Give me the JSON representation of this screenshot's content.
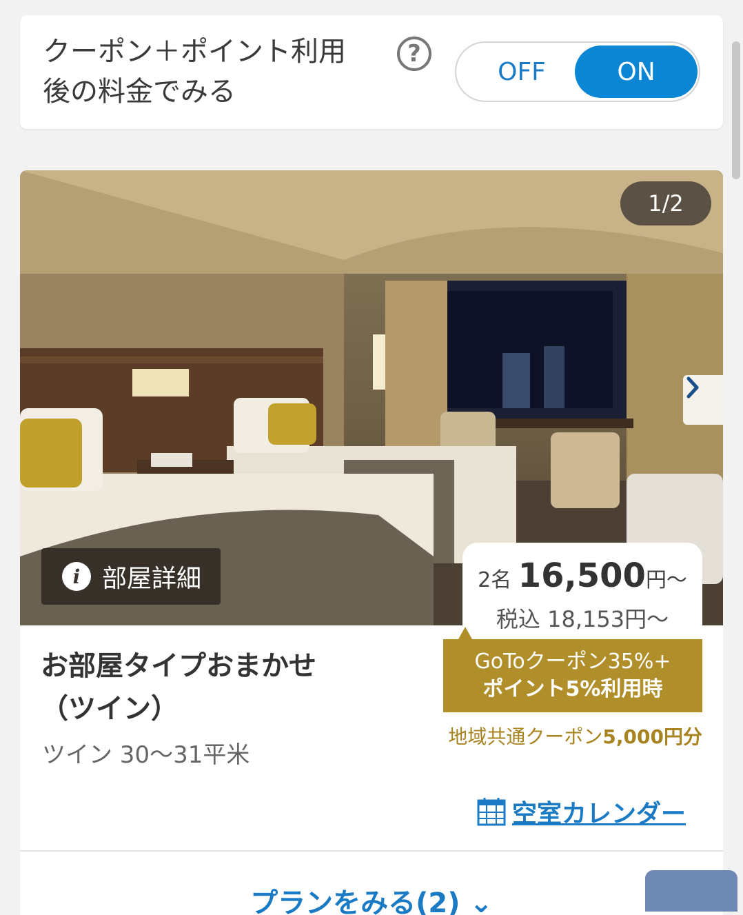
{
  "toggle": {
    "label": "クーポン＋ポイント利用\n後の料金でみる",
    "help_glyph": "?",
    "off_label": "OFF",
    "on_label": "ON"
  },
  "room": {
    "image_counter": "1/2",
    "room_detail_label": "部屋詳細",
    "info_glyph": "i",
    "title": "お部屋タイプおまかせ\n（ツイン）",
    "subtitle": "ツイン 30〜31平米",
    "price": {
      "guests": "2名",
      "amount": "16,500",
      "unit": "円〜",
      "tax_included": "税込 18,153円〜"
    },
    "coupon": {
      "line1": "GoToクーポン35%+",
      "line2": "ポイント5%利用時"
    },
    "regional_coupon": {
      "prefix": "地域共通クーポン",
      "amount": "5,000円分"
    },
    "calendar_link": "空室カレンダー",
    "plans_link": "プランをみる(2) ⌄"
  },
  "colors": {
    "accent_blue": "#0a86d4",
    "coupon_gold": "#b08e2a"
  }
}
